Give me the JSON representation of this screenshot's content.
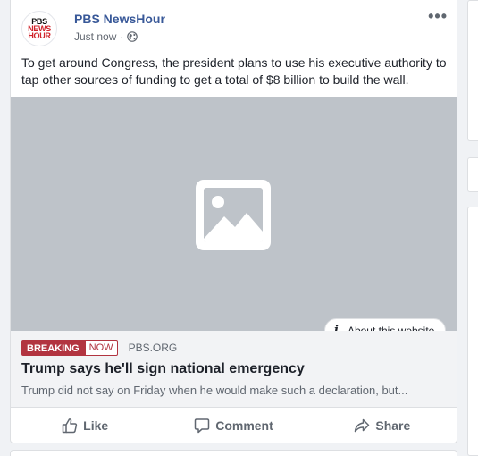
{
  "post": {
    "page_name": "PBS NewsHour",
    "logo_lines": [
      "PBS",
      "NEWS",
      "HOUR"
    ],
    "timestamp": "Just now",
    "separator": "·",
    "privacy_icon": "globe-icon",
    "more_label": "•••",
    "text": "To get around Congress, the president plans to use his executive authority to tap other sources of funding to get a total of $8 billion to build the wall."
  },
  "image": {
    "placeholder_icon": "image-placeholder-icon",
    "about_label": "About this website",
    "about_icon": "info-icon",
    "about_icon_glyph": "i"
  },
  "link": {
    "tag_breaking": "BREAKING",
    "tag_now": "NOW",
    "domain": "PBS.ORG",
    "title": "Trump says he'll sign national emergency",
    "description": "Trump did not say on Friday when he would make such a declaration, but..."
  },
  "actions": {
    "like": "Like",
    "comment": "Comment",
    "share": "Share"
  },
  "colors": {
    "page_name": "#385898",
    "breaking": "#b23440",
    "image_bg": "#bec3c9",
    "preview_bg": "#f2f3f5"
  }
}
